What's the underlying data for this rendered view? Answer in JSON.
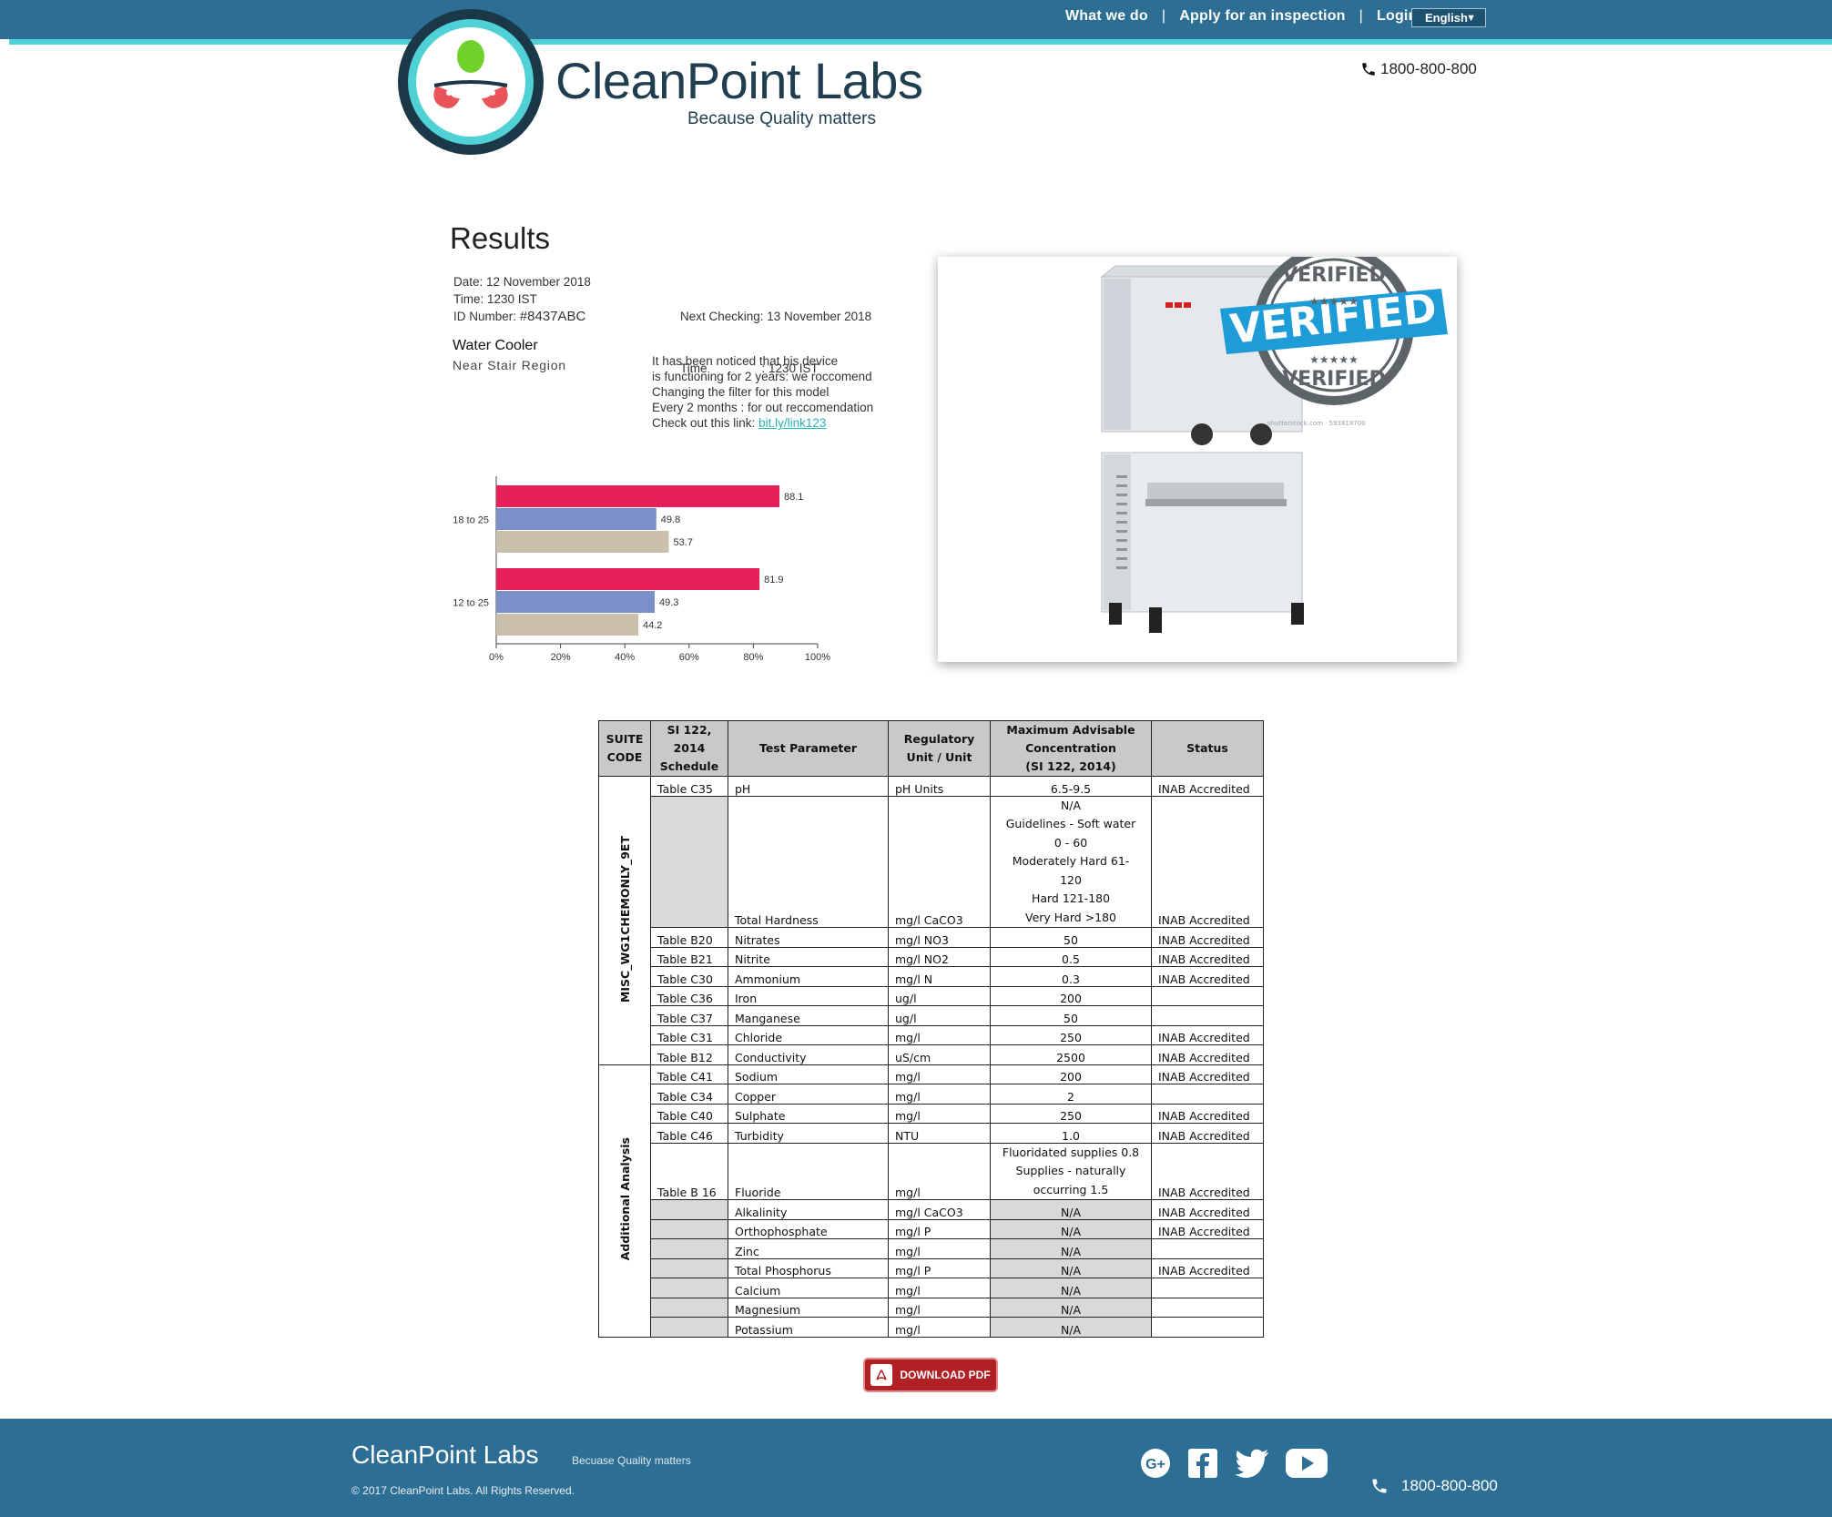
{
  "nav": {
    "items": [
      "What we do",
      "Apply for an inspection",
      "Login"
    ],
    "language": "English"
  },
  "header": {
    "brand": "CleanPoint Labs",
    "tagline": "Because Quality matters",
    "phone": "1800-800-800"
  },
  "results": {
    "title": "Results",
    "date": "Date: 12 November 2018",
    "time": "Time: 1230 IST",
    "id_label": "ID Number:",
    "id_value": "#8437ABC",
    "next_checking": "Next Checking: 13 November 2018",
    "next_time": "Time                : 1230 IST",
    "device_name": "Water Cooler",
    "device_location": "Near Stair Region",
    "note_lines": [
      "It has been noticed that his device",
      "is functioning for 2 years: we roccomend",
      "Changing the filter for this model",
      "Every 2 months : for out reccomendation"
    ],
    "note_link_prefix": "Check out this link:",
    "note_link": "bit.ly/link123"
  },
  "chart_data": {
    "type": "bar",
    "orientation": "horizontal",
    "categories": [
      "18 to 25",
      "12 to 25"
    ],
    "series": [
      {
        "values": [
          88.1,
          81.9
        ],
        "color": "#e8205a"
      },
      {
        "values": [
          49.8,
          49.3
        ],
        "color": "#7b8fc9"
      },
      {
        "values": [
          53.7,
          44.2
        ],
        "color": "#c9bfaa"
      }
    ],
    "xlim": [
      0,
      100
    ],
    "xticks": [
      "0%",
      "20%",
      "40%",
      "60%",
      "80%",
      "100%"
    ],
    "grid": false
  },
  "image": {
    "stamp_text": "VERIFIED",
    "watermark": "shutterstock.com · 593818700"
  },
  "table": {
    "headers": [
      "SUITE CODE",
      "SI 122, 2014 Schedule",
      "Test Parameter",
      "Regulatory Unit / Unit",
      "Maximum Advisable Concentration (SI 122, 2014)",
      "Status"
    ],
    "groups": [
      {
        "suite": "MISC_WG1CHEMONLY_9ET",
        "rows": [
          {
            "schedule": "Table C35",
            "param": "pH",
            "unit": "pH Units",
            "max": "6.5-9.5",
            "status": "INAB Accredited"
          },
          {
            "schedule": "",
            "param": "Total Hardness",
            "unit": "mg/l CaCO3",
            "max_lines": [
              "N/A",
              "Guidelines - Soft water",
              "0 - 60",
              "Moderately Hard 61-",
              "120",
              "Hard 121-180",
              "Very Hard >180"
            ],
            "status": "INAB Accredited",
            "grey_schedule": true
          },
          {
            "schedule": "Table B20",
            "param": "Nitrates",
            "unit": "mg/l NO3",
            "max": "50",
            "status": "INAB Accredited"
          },
          {
            "schedule": "Table B21",
            "param": "Nitrite",
            "unit": "mg/l NO2",
            "max": "0.5",
            "status": "INAB Accredited"
          },
          {
            "schedule": "Table C30",
            "param": "Ammonium",
            "unit": "mg/l N",
            "max": "0.3",
            "status": "INAB Accredited"
          },
          {
            "schedule": "Table C36",
            "param": "Iron",
            "unit": "ug/l",
            "max": "200",
            "status": ""
          },
          {
            "schedule": "Table C37",
            "param": "Manganese",
            "unit": "ug/l",
            "max": "50",
            "status": ""
          },
          {
            "schedule": "Table C31",
            "param": "Chloride",
            "unit": "mg/l",
            "max": "250",
            "status": "INAB Accredited"
          },
          {
            "schedule": "Table B12",
            "param": "Conductivity",
            "unit": "uS/cm",
            "max": "2500",
            "status": "INAB Accredited"
          }
        ]
      },
      {
        "suite": "Additional Analysis",
        "rows": [
          {
            "schedule": "Table C41",
            "param": "Sodium",
            "unit": "mg/l",
            "max": "200",
            "status": "INAB Accredited"
          },
          {
            "schedule": "Table C34",
            "param": "Copper",
            "unit": "mg/l",
            "max": "2",
            "status": ""
          },
          {
            "schedule": "Table C40",
            "param": "Sulphate",
            "unit": "mg/l",
            "max": "250",
            "status": "INAB Accredited"
          },
          {
            "schedule": "Table C46",
            "param": "Turbidity",
            "unit": "NTU",
            "max": "1.0",
            "status": "INAB Accredited"
          },
          {
            "schedule": "Table B 16",
            "param": "Fluoride",
            "unit": "mg/l",
            "max_lines": [
              "Fluoridated supplies 0.8",
              "Supplies - naturally",
              "occurring 1.5"
            ],
            "status": "INAB Accredited"
          },
          {
            "schedule": "",
            "param": "Alkalinity",
            "unit": "mg/l CaCO3",
            "max": "N/A",
            "status": "INAB Accredited",
            "grey_schedule": true,
            "grey_max": true
          },
          {
            "schedule": "",
            "param": "Orthophosphate",
            "unit": "mg/l P",
            "max": "N/A",
            "status": "INAB Accredited",
            "grey_schedule": true,
            "grey_max": true
          },
          {
            "schedule": "",
            "param": "Zinc",
            "unit": "mg/l",
            "max": "N/A",
            "status": "",
            "grey_schedule": true,
            "grey_max": true
          },
          {
            "schedule": "",
            "param": "Total Phosphorus",
            "unit": "mg/l P",
            "max": "N/A",
            "status": "INAB Accredited",
            "grey_schedule": true,
            "grey_max": true
          },
          {
            "schedule": "",
            "param": "Calcium",
            "unit": "mg/l",
            "max": "N/A",
            "status": "",
            "grey_schedule": true,
            "grey_max": true
          },
          {
            "schedule": "",
            "param": "Magnesium",
            "unit": "mg/l",
            "max": "N/A",
            "status": "",
            "grey_schedule": true,
            "grey_max": true
          },
          {
            "schedule": "",
            "param": "Potassium",
            "unit": "mg/l",
            "max": "N/A",
            "status": "",
            "grey_schedule": true,
            "grey_max": true
          }
        ]
      }
    ]
  },
  "download": {
    "label": "DOWNLOAD PDF"
  },
  "footer": {
    "brand": "CleanPoint Labs",
    "tagline": "Becuase Quality matters",
    "copyright": "© 2017 CleanPoint Labs. All Rights Reserved.",
    "social": [
      "google-plus-icon",
      "facebook-icon",
      "twitter-icon",
      "youtube-icon"
    ],
    "phone": "1800-800-800"
  },
  "colors": {
    "brand_blue": "#2d6e94",
    "accent_teal": "#4fd1d6",
    "logo_green": "#6fd12a",
    "logo_red": "#e8545a",
    "download_red": "#b12025"
  }
}
